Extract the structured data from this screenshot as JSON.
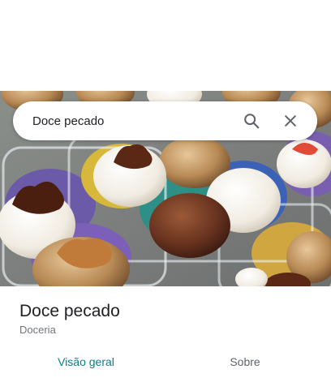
{
  "search": {
    "query": "Doce pecado",
    "search_icon": "magnifier-icon",
    "close_icon": "close-x-icon"
  },
  "place": {
    "name": "Doce pecado",
    "category": "Doceria"
  },
  "tabs": [
    {
      "label": "Visão geral",
      "selected": true
    },
    {
      "label": "Sobre",
      "selected": false
    }
  ],
  "colors": {
    "accent": "#0b7f86",
    "text_primary": "#202124",
    "text_secondary": "#70757a"
  }
}
